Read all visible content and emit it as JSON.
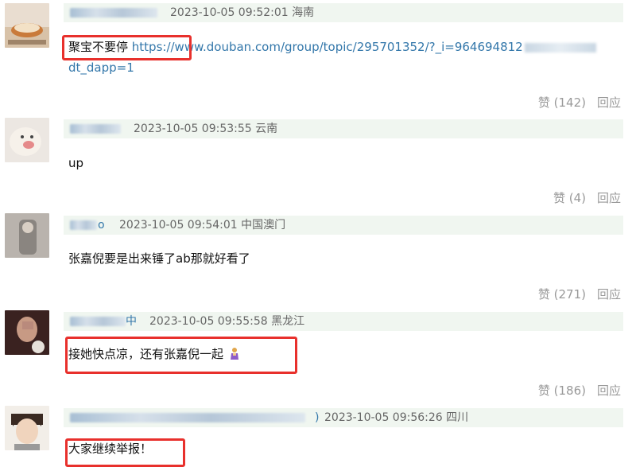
{
  "comments": [
    {
      "username_tail": "",
      "time": "2023-10-05 09:52:01",
      "location": "海南",
      "text_prefix": "聚宝不要停 ",
      "link_text": "https://www.douban.com/group/topic/295701352/?_i=964694812",
      "link_text_cont": "dt_dapp=1",
      "like_label": "赞 (142)",
      "reply_label": "回应"
    },
    {
      "username_tail": "",
      "time": "2023-10-05 09:53:55",
      "location": "云南",
      "text": "up",
      "like_label": "赞 (4)",
      "reply_label": "回应"
    },
    {
      "username_tail": "o",
      "time": "2023-10-05 09:54:01",
      "location": "中国澳门",
      "text": "张嘉倪要是出来锤了ab那就好看了",
      "like_label": "赞 (271)",
      "reply_label": "回应"
    },
    {
      "username_tail": "中",
      "time": "2023-10-05 09:55:58",
      "location": "黑龙江",
      "text": "接她快点凉，还有张嘉倪一起",
      "like_label": "赞 (186)",
      "reply_label": "回应"
    },
    {
      "username_tail": ")",
      "time": "2023-10-05 09:56:26",
      "location": "四川",
      "text": "大家继续举报！"
    }
  ],
  "colors": {
    "link": "#3377aa",
    "highlight_box": "#e8302c",
    "meta_bg": "#f0f6f0",
    "muted": "#999999"
  }
}
